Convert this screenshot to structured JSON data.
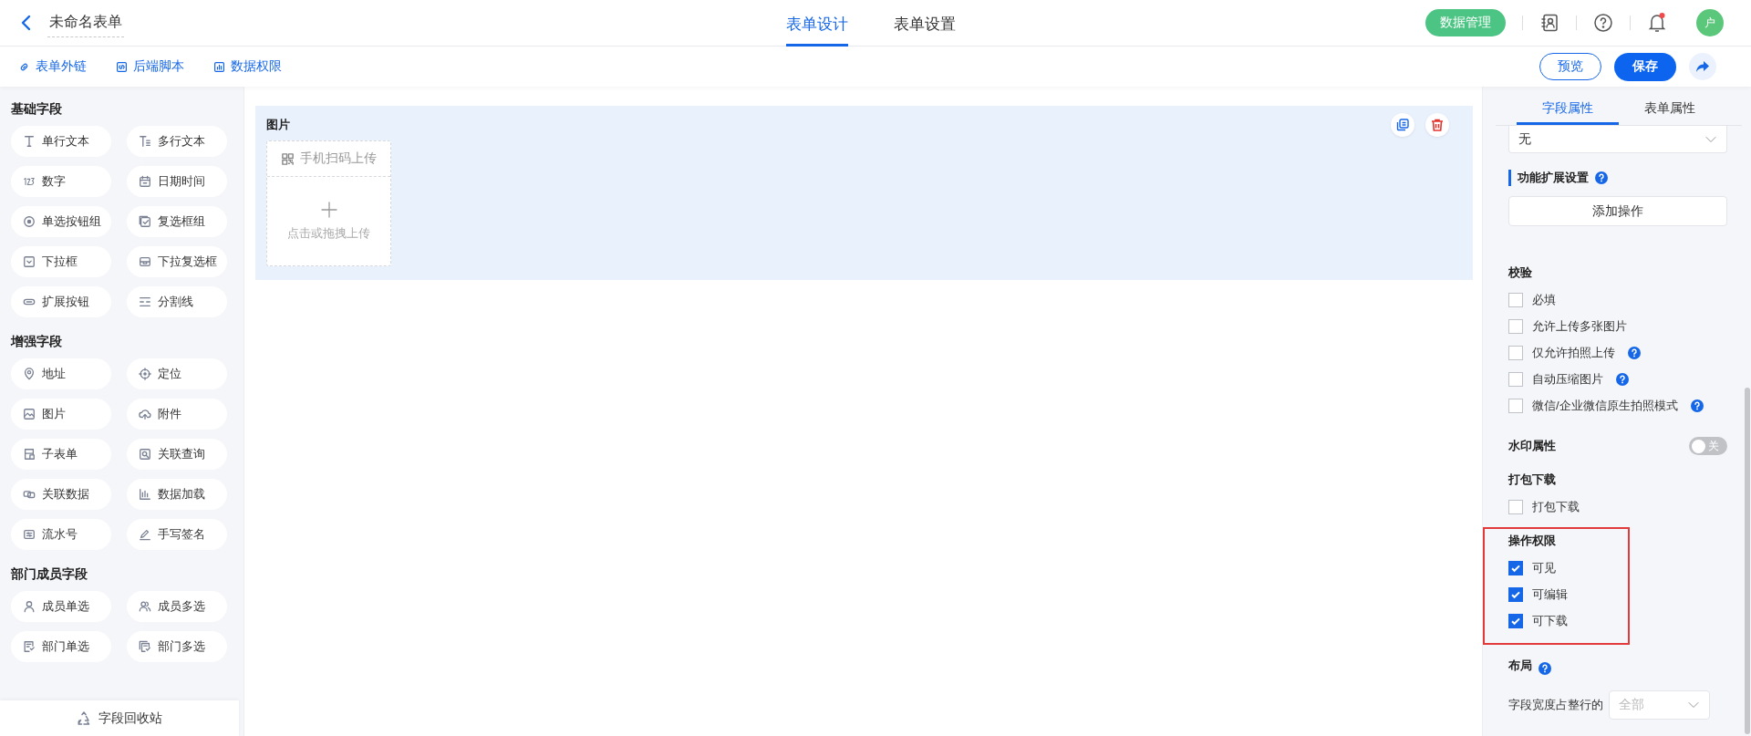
{
  "header": {
    "title": "未命名表单",
    "tabs": [
      {
        "label": "表单设计",
        "selected": true
      },
      {
        "label": "表单设置",
        "selected": false
      }
    ],
    "data_button": "数据管理",
    "avatar": "户",
    "notification_dot": true
  },
  "toolbar": {
    "links": [
      {
        "label": "表单外链",
        "kind": "link"
      },
      {
        "label": "后端脚本",
        "kind": "code"
      },
      {
        "label": "数据权限",
        "kind": "chart"
      }
    ],
    "preview": "预览",
    "save": "保存"
  },
  "palette": {
    "groups": [
      {
        "title": "基础字段",
        "items": [
          {
            "label": "单行文本",
            "kind": "text"
          },
          {
            "label": "多行文本",
            "kind": "multitext"
          },
          {
            "label": "数字",
            "kind": "number"
          },
          {
            "label": "日期时间",
            "kind": "calendar"
          },
          {
            "label": "单选按钮组",
            "kind": "radio"
          },
          {
            "label": "复选框组",
            "kind": "checkbox"
          },
          {
            "label": "下拉框",
            "kind": "dropdown"
          },
          {
            "label": "下拉复选框",
            "kind": "dropcheck"
          },
          {
            "label": "扩展按钮",
            "kind": "pill"
          },
          {
            "label": "分割线",
            "kind": "divider"
          }
        ]
      },
      {
        "title": "增强字段",
        "items": [
          {
            "label": "地址",
            "kind": "pin"
          },
          {
            "label": "定位",
            "kind": "target"
          },
          {
            "label": "图片",
            "kind": "image"
          },
          {
            "label": "附件",
            "kind": "cloud"
          },
          {
            "label": "子表单",
            "kind": "subform"
          },
          {
            "label": "关联查询",
            "kind": "search"
          },
          {
            "label": "关联数据",
            "kind": "chain"
          },
          {
            "label": "数据加载",
            "kind": "bars"
          },
          {
            "label": "流水号",
            "kind": "serial"
          },
          {
            "label": "手写签名",
            "kind": "pen"
          }
        ]
      },
      {
        "title": "部门成员字段",
        "items": [
          {
            "label": "成员单选",
            "kind": "user"
          },
          {
            "label": "成员多选",
            "kind": "users"
          },
          {
            "label": "部门单选",
            "kind": "dept"
          },
          {
            "label": "部门多选",
            "kind": "depts"
          }
        ]
      }
    ],
    "recycle": "字段回收站"
  },
  "canvas": {
    "field": {
      "label": "图片",
      "scan": "手机扫码上传",
      "upload": "点击或拖拽上传",
      "selected": true
    }
  },
  "properties": {
    "tabs": [
      {
        "label": "字段属性",
        "selected": true
      },
      {
        "label": "表单属性",
        "selected": false
      }
    ],
    "sections": [
      {
        "kind": "select",
        "value": "无"
      },
      {
        "kind": "extension",
        "title": "功能扩展设置",
        "help": true,
        "button": "添加操作"
      },
      {
        "kind": "checks",
        "title": "校验",
        "highlighted": false,
        "options": [
          {
            "label": "必填",
            "checked": false,
            "help": false
          },
          {
            "label": "允许上传多张图片",
            "checked": false,
            "help": false
          },
          {
            "label": "仅允许拍照上传",
            "checked": false,
            "help": true
          },
          {
            "label": "自动压缩图片",
            "checked": false,
            "help": true
          },
          {
            "label": "微信/企业微信原生拍照模式",
            "checked": false,
            "help": true
          }
        ]
      },
      {
        "kind": "toggle",
        "title": "水印属性",
        "on": false,
        "state_label": "关"
      },
      {
        "kind": "checks",
        "title": "打包下载",
        "highlighted": false,
        "options": [
          {
            "label": "打包下载",
            "checked": false,
            "help": false
          }
        ]
      },
      {
        "kind": "checks",
        "title": "操作权限",
        "highlighted": true,
        "options": [
          {
            "label": "可见",
            "checked": true,
            "help": false
          },
          {
            "label": "可编辑",
            "checked": true,
            "help": false
          },
          {
            "label": "可下载",
            "checked": true,
            "help": false
          }
        ]
      },
      {
        "kind": "layout",
        "title": "布局",
        "help": true,
        "label": "字段宽度占整行的",
        "value": "全部"
      }
    ]
  }
}
